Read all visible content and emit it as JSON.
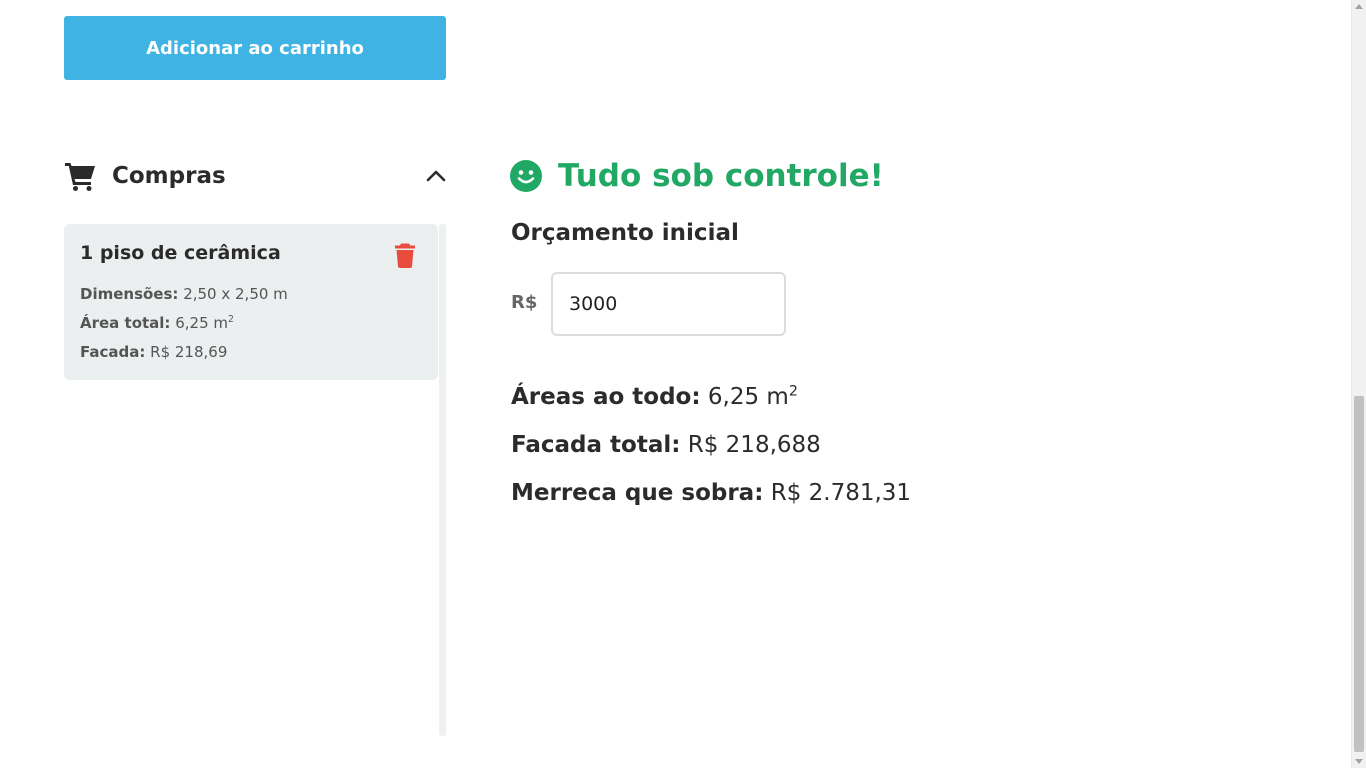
{
  "actions": {
    "add_to_cart_label": "Adicionar ao carrinho"
  },
  "cart": {
    "icon": "shopping-cart-icon",
    "title": "Compras",
    "collapse_icon": "chevron-up-icon",
    "items": [
      {
        "title": "1 piso de cerâmica",
        "delete_icon": "trash-icon",
        "dimensions_label": "Dimensões:",
        "dimensions_value": "2,50 x 2,50 m",
        "area_label": "Área total:",
        "area_value": "6,25 m",
        "area_exp": "2",
        "cost_label": "Facada:",
        "cost_value": "R$ 218,69"
      }
    ]
  },
  "status": {
    "icon": "smile-icon",
    "text": "Tudo sob controle!",
    "color": "#21a864"
  },
  "budget": {
    "label": "Orçamento inicial",
    "currency": "R$",
    "value": "3000"
  },
  "summary": {
    "areas_label": "Áreas ao todo:",
    "areas_value": "6,25 m",
    "areas_exp": "2",
    "total_label": "Facada total:",
    "total_value": "R$ 218,688",
    "left_label": "Merreca que sobra:",
    "left_value": "R$ 2.781,31"
  },
  "colors": {
    "accent": "#3eb3e4",
    "danger": "#e74c3c",
    "success": "#21a864"
  }
}
